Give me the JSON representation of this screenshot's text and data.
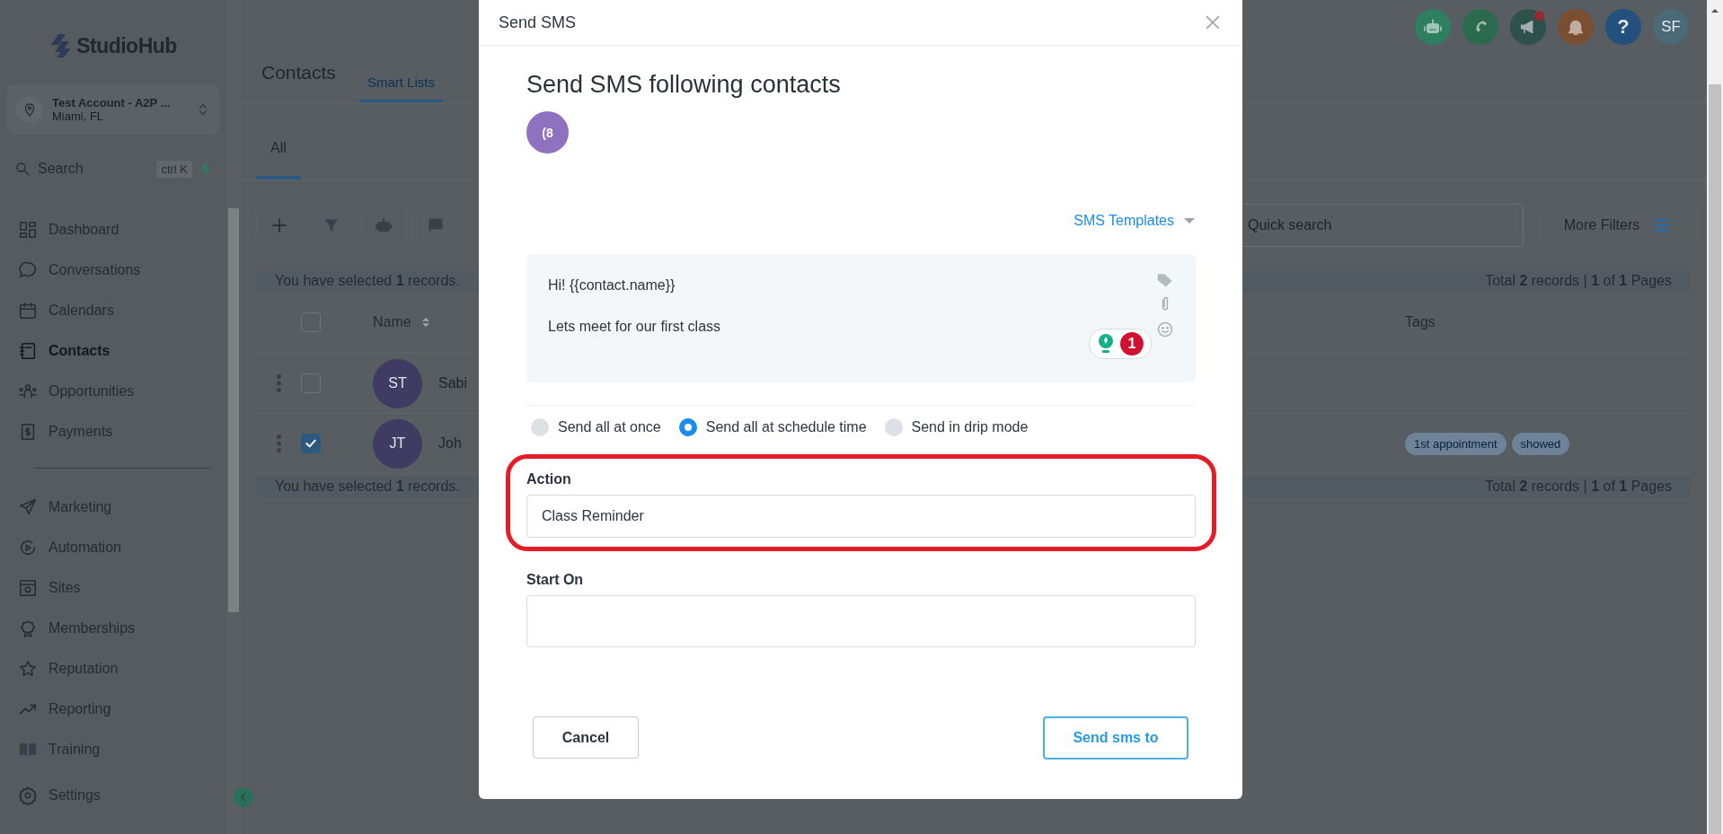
{
  "sidebar": {
    "logo": "StudioHub",
    "account": {
      "name": "Test Account - A2P ...",
      "location": "Miami, FL"
    },
    "search": {
      "placeholder": "Search",
      "shortcut": "ctrl K"
    },
    "nav_groups": [
      [
        {
          "label": "Dashboard",
          "selected": false
        },
        {
          "label": "Conversations",
          "selected": false
        },
        {
          "label": "Calendars",
          "selected": false
        },
        {
          "label": "Contacts",
          "selected": true
        },
        {
          "label": "Opportunities",
          "selected": false
        },
        {
          "label": "Payments",
          "selected": false
        }
      ],
      [
        {
          "label": "Marketing",
          "selected": false
        },
        {
          "label": "Automation",
          "selected": false
        },
        {
          "label": "Sites",
          "selected": false
        },
        {
          "label": "Memberships",
          "selected": false
        },
        {
          "label": "Reputation",
          "selected": false
        },
        {
          "label": "Reporting",
          "selected": false
        },
        {
          "label": "Training",
          "selected": false
        }
      ]
    ],
    "settings": "Settings"
  },
  "header": {
    "page_title": "Contacts",
    "tabs": [
      {
        "label": "Smart Lists",
        "selected": true
      }
    ],
    "actions": [
      {
        "kind": "robot",
        "badge": false
      },
      {
        "kind": "phone",
        "badge": false
      },
      {
        "kind": "megaphone",
        "badge": true
      },
      {
        "kind": "bell",
        "badge": false
      },
      {
        "kind": "help",
        "text": "?",
        "badge": false
      }
    ],
    "avatar": "SF"
  },
  "list_tabs": [
    {
      "label": "All",
      "selected": true
    }
  ],
  "toolbar": [
    {
      "kind": "add"
    },
    {
      "kind": "filter"
    },
    {
      "kind": "robot"
    },
    {
      "kind": "message"
    }
  ],
  "quick_search": {
    "placeholder": "Quick search"
  },
  "more_filters": "More Filters",
  "table": {
    "selection_note": "You have selected **1** records.",
    "total": "Total **2** records | **1** of **1** Pages",
    "header_checked": false,
    "columns": [
      "Name",
      "Tags"
    ],
    "rows": [
      {
        "initials": "ST",
        "name": "Sabi",
        "checked": false,
        "tags": []
      },
      {
        "initials": "JT",
        "name": "Joh",
        "checked": true,
        "tags": [
          "1st appointment",
          "showed"
        ]
      }
    ],
    "footer_note": "You have selected **1** records.",
    "footer_total": "Total **2** records | **1** of **1** Pages"
  },
  "modal": {
    "title": "Send SMS",
    "heading": "Send SMS following contacts",
    "recipients": [
      {
        "initials": "(8"
      }
    ],
    "templates": "SMS Templates",
    "message": [
      "Hi! {{contact.name}}",
      "Lets meet for our first class"
    ],
    "suggestions": "1",
    "send_modes": [
      {
        "label": "Send all at once",
        "selected": false
      },
      {
        "label": "Send all at schedule time",
        "selected": true
      },
      {
        "label": "Send in drip mode",
        "selected": false
      }
    ],
    "fields": [
      {
        "label": "Action",
        "value": "Class Reminder",
        "highlighted": true
      },
      {
        "label": "Start On",
        "highlighted": false
      }
    ],
    "cancel": "Cancel",
    "submit": "Send sms to"
  }
}
